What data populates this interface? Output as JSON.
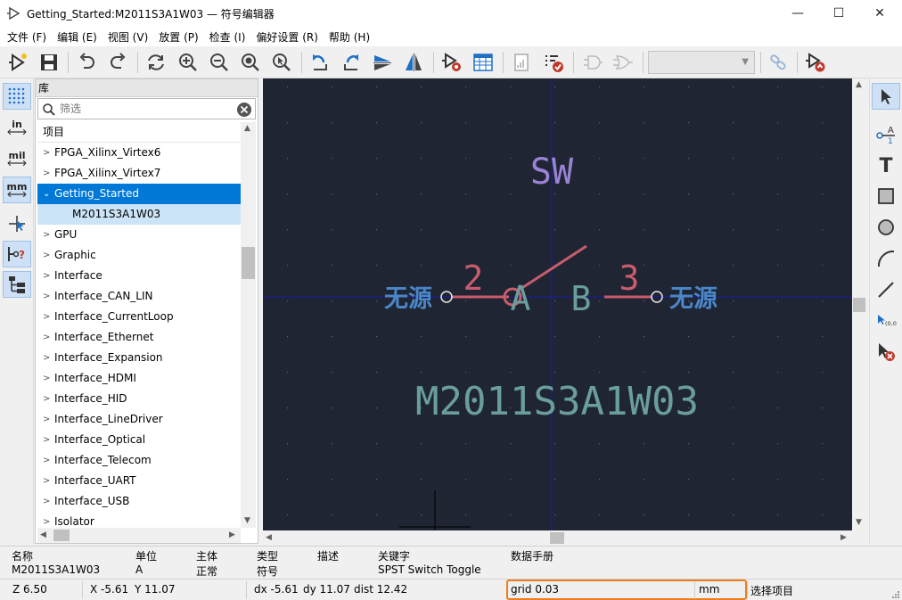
{
  "window": {
    "title": "Getting_Started:M2011S3A1W03 — 符号编辑器",
    "minimize_glyph": "—",
    "maximize_glyph": "☐",
    "close_glyph": "✕"
  },
  "menu": [
    "文件 (F)",
    "编辑 (E)",
    "视图 (V)",
    "放置 (P)",
    "检查 (I)",
    "偏好设置 (R)",
    "帮助 (H)"
  ],
  "toolbar": {
    "icons": [
      "new-symbol-icon",
      "save-icon",
      "undo-icon",
      "redo-icon",
      "refresh-icon",
      "zoom-in-icon",
      "zoom-out-icon",
      "zoom-fit-icon",
      "zoom-selection-icon",
      "rotate-ccw-icon",
      "rotate-cw-icon",
      "mirror-vertical-icon",
      "mirror-horizontal-icon",
      "symbol-properties-icon",
      "pin-table-icon",
      "datasheet-icon",
      "check-symbol-icon",
      "de-morgan-standard-icon",
      "de-morgan-alternate-icon",
      "unit-selector",
      "sync-pins-icon",
      "update-schematic-icon"
    ],
    "unit_select_value": ""
  },
  "left_toolbar": {
    "unit_in": "in",
    "unit_mil": "mil",
    "unit_mm": "mm"
  },
  "library": {
    "header": "库",
    "search_placeholder": "筛选",
    "tree_header": "项目",
    "items": [
      {
        "label": "FPGA_Xilinx_Virtex6",
        "state": "collapsed"
      },
      {
        "label": "FPGA_Xilinx_Virtex7",
        "state": "collapsed"
      },
      {
        "label": "Getting_Started",
        "state": "expanded"
      },
      {
        "label": "M2011S3A1W03",
        "state": "child"
      },
      {
        "label": "GPU",
        "state": "collapsed"
      },
      {
        "label": "Graphic",
        "state": "collapsed"
      },
      {
        "label": "Interface",
        "state": "collapsed"
      },
      {
        "label": "Interface_CAN_LIN",
        "state": "collapsed"
      },
      {
        "label": "Interface_CurrentLoop",
        "state": "collapsed"
      },
      {
        "label": "Interface_Ethernet",
        "state": "collapsed"
      },
      {
        "label": "Interface_Expansion",
        "state": "collapsed"
      },
      {
        "label": "Interface_HDMI",
        "state": "collapsed"
      },
      {
        "label": "Interface_HID",
        "state": "collapsed"
      },
      {
        "label": "Interface_LineDriver",
        "state": "collapsed"
      },
      {
        "label": "Interface_Optical",
        "state": "collapsed"
      },
      {
        "label": "Interface_Telecom",
        "state": "collapsed"
      },
      {
        "label": "Interface_UART",
        "state": "collapsed"
      },
      {
        "label": "Interface_USB",
        "state": "collapsed"
      },
      {
        "label": "Isolator",
        "state": "collapsed"
      }
    ]
  },
  "symbol": {
    "reference": "SW",
    "value": "M2011S3A1W03",
    "pin_left_number": "2",
    "pin_left_name": "A",
    "pin_left_type": "无源",
    "pin_right_number": "3",
    "pin_right_name": "B",
    "pin_right_type": "无源",
    "colors": {
      "background": "#1f2533",
      "reference": "#9a83d4",
      "value": "#6a9e9e",
      "pin_number": "#c85c6c",
      "pin_name": "#6a9e9e",
      "pin_type": "#4a86c8",
      "body": "#c85c6c",
      "axis": "#1a1aa8",
      "grid_dot": "#5a6272"
    }
  },
  "message_panel": {
    "name_label": "名称",
    "name_value": "M2011S3A1W03",
    "unit_label": "单位",
    "unit_value": "A",
    "body_label": "主体",
    "body_value": "正常",
    "type_label": "类型",
    "type_value": "符号",
    "desc_label": "描述",
    "desc_value": "",
    "keywords_label": "关键字",
    "keywords_value": "SPST Switch Toggle",
    "datasheet_label": "数据手册",
    "datasheet_value": ""
  },
  "status": {
    "zoom": "Z 6.50",
    "x": "X -5.61",
    "y": "Y 11.07",
    "dx": "dx -5.61",
    "dy": "dy 11.07",
    "dist": "dist 12.42",
    "grid": "grid 0.03",
    "units": "mm",
    "mode": "选择项目",
    "highlight_color": "#ef7d1a"
  }
}
